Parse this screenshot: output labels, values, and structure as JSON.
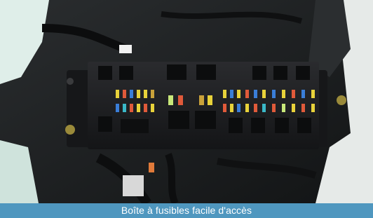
{
  "caption": "Boîte à fusibles facile d'accès",
  "colors": {
    "caption_bar": "#4f97bf",
    "fuse_box": "#1b1c1e",
    "frame_left": "#cfe3dc",
    "frame_right": "#e9ecea"
  }
}
